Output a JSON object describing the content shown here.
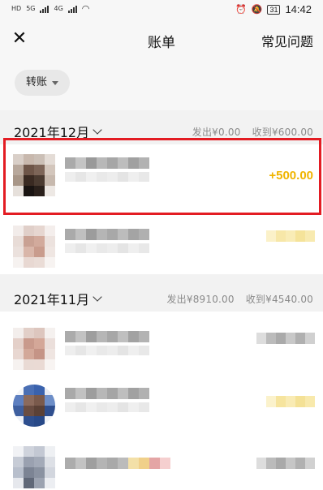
{
  "status_bar": {
    "time": "14:42",
    "battery": "31",
    "signal_left_1": "HD",
    "signal_left_2": "HD",
    "net_1": "5G",
    "net_2": "4G"
  },
  "header": {
    "title": "账单",
    "faq_label": "常见问题"
  },
  "filter": {
    "label": "转账"
  },
  "months": [
    {
      "label": "2021年12月",
      "outgoing": "发出¥0.00",
      "incoming": "收到¥600.00",
      "items": [
        {
          "amount": "+500.00"
        },
        {
          "amount": ""
        }
      ]
    },
    {
      "label": "2021年11月",
      "outgoing": "发出¥8910.00",
      "incoming": "收到¥4540.00",
      "items": [
        {
          "amount": ""
        },
        {
          "amount": ""
        },
        {
          "amount": ""
        }
      ]
    }
  ],
  "colors": {
    "income_amount": "#f0b400",
    "highlight_border": "#e31c23",
    "section_bg": "#f2f2f2"
  }
}
